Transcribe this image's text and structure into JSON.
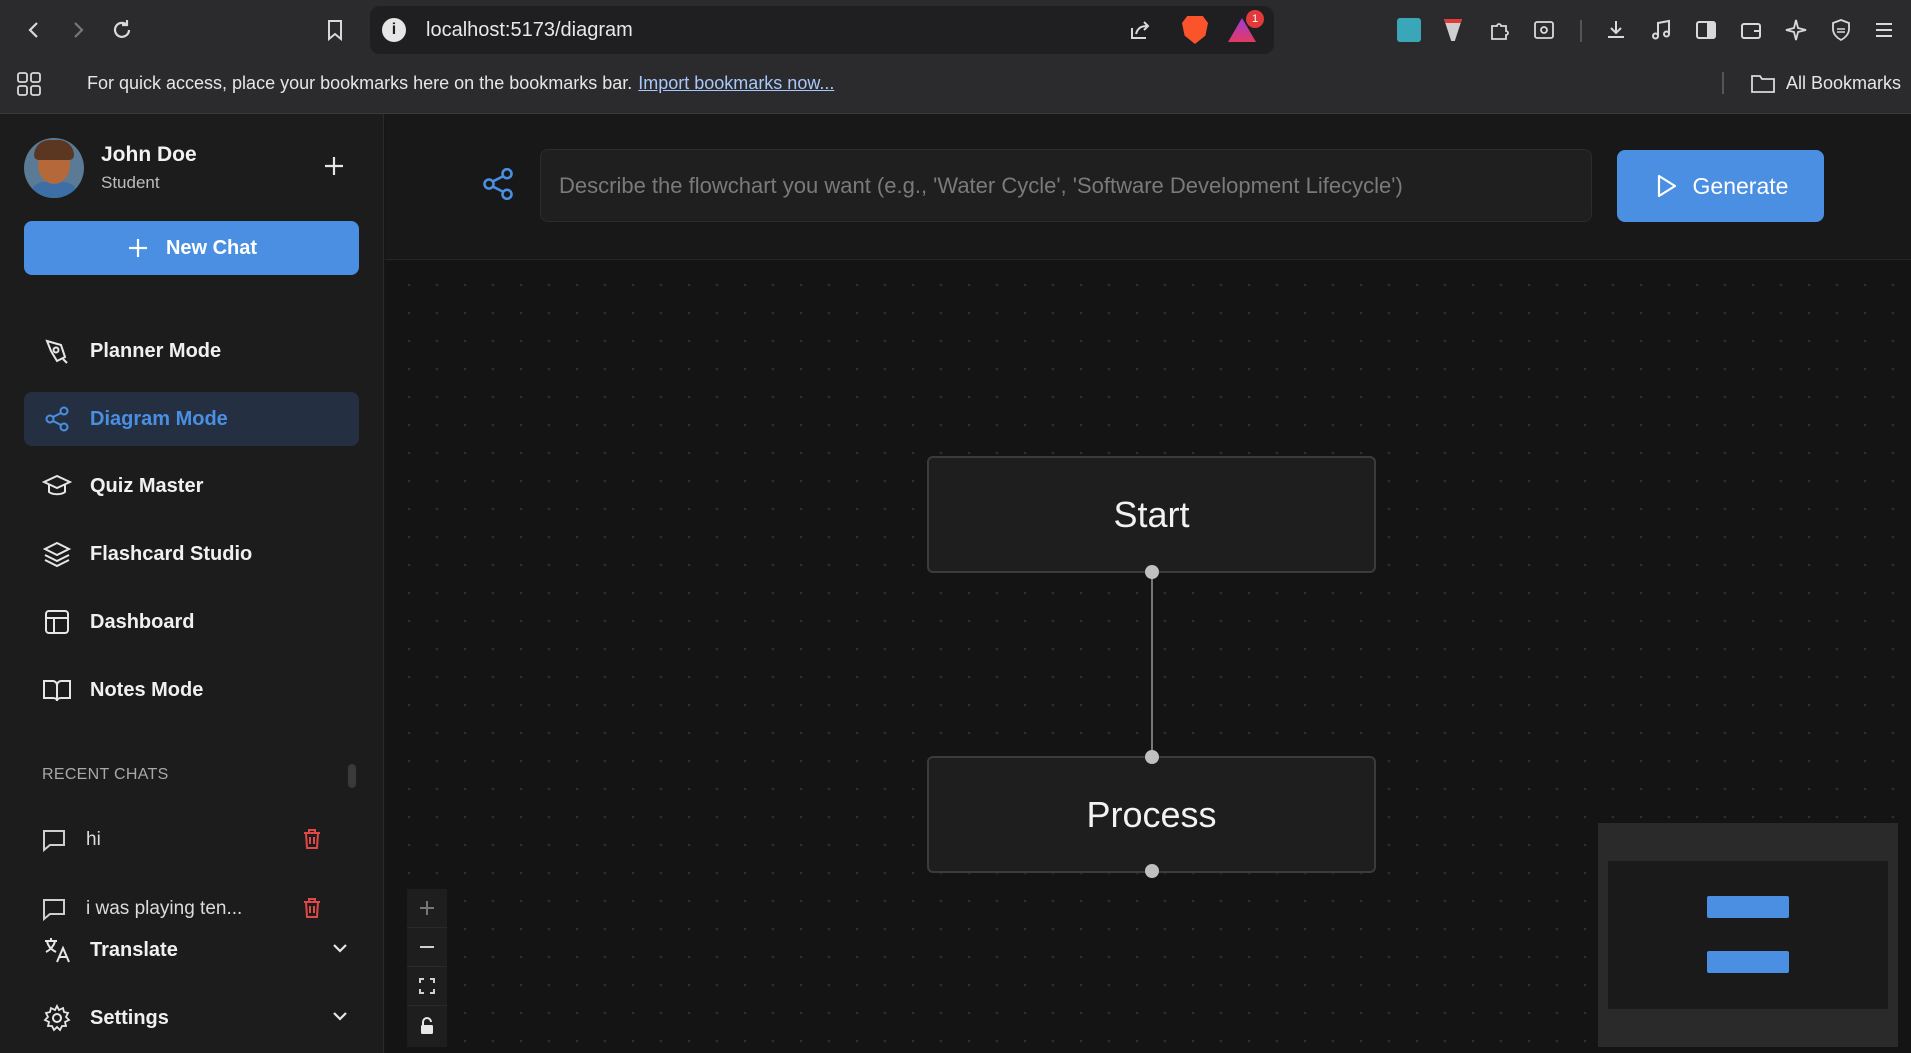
{
  "browser": {
    "url": "localhost:5173/diagram",
    "bookmarks_hint": "For quick access, place your bookmarks here on the bookmarks bar.",
    "import_link": "Import bookmarks now...",
    "all_bookmarks": "All Bookmarks",
    "notification_count": "1"
  },
  "profile": {
    "name": "John Doe",
    "role": "Student"
  },
  "sidebar": {
    "new_chat": "New Chat",
    "items": [
      {
        "label": "Planner Mode",
        "icon": "pen-tool-icon"
      },
      {
        "label": "Diagram Mode",
        "icon": "share-icon",
        "active": true
      },
      {
        "label": "Quiz Master",
        "icon": "graduation-cap-icon"
      },
      {
        "label": "Flashcard Studio",
        "icon": "layers-icon"
      },
      {
        "label": "Dashboard",
        "icon": "layout-icon"
      },
      {
        "label": "Notes Mode",
        "icon": "book-open-icon"
      }
    ],
    "recent_title": "RECENT CHATS",
    "recent_chats": [
      "hi",
      "i was playing ten..."
    ],
    "footer": {
      "translate": "Translate",
      "settings": "Settings"
    }
  },
  "main": {
    "prompt_placeholder": "Describe the flowchart you want (e.g., 'Water Cycle', 'Software Development Lifecycle')",
    "generate_label": "Generate",
    "nodes": [
      "Start",
      "Process"
    ]
  },
  "colors": {
    "accent": "#4a8fe2",
    "delete": "#e04848",
    "background": "#141414"
  }
}
